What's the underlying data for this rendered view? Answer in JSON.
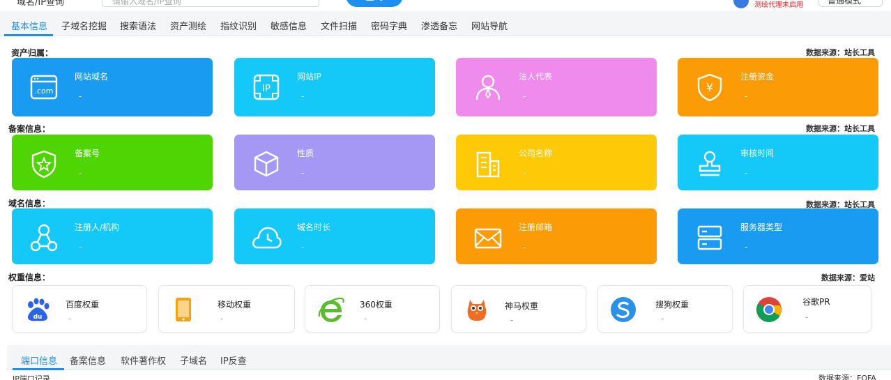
{
  "topbar": {
    "left_text": "域名/IP查询",
    "search_placeholder": "请输入域名/IP查询",
    "query_button": "查询",
    "proxy_status": "测绘代理未启用",
    "mode_select": "普通模式"
  },
  "nav": {
    "tabs": [
      "基本信息",
      "子域名挖掘",
      "搜索语法",
      "资产测绘",
      "指纹识别",
      "敏感信息",
      "文件扫描",
      "密码字典",
      "渗透备忘",
      "网站导航"
    ],
    "active": "基本信息"
  },
  "sections": {
    "asset": {
      "title": "资产归属：",
      "source": "数据来源：站长工具"
    },
    "icp": {
      "title": "备案信息：",
      "source": "数据来源：站长工具"
    },
    "domain": {
      "title": "域名信息：",
      "source": "数据来源：站长工具"
    },
    "weight": {
      "title": "权重信息：",
      "source": "数据来源：爱站"
    }
  },
  "cards": {
    "site_domain": {
      "label": "网站域名",
      "value": "-",
      "color": "#1a9bf2",
      "icon": "domain-com-icon"
    },
    "site_ip": {
      "label": "网站IP",
      "value": "-",
      "color": "#14c8f7",
      "icon": "ip-icon"
    },
    "legal_rep": {
      "label": "法人代表",
      "value": "-",
      "color": "#f08bee",
      "icon": "person-icon"
    },
    "reg_capital": {
      "label": "注册资金",
      "value": "-",
      "color": "#fb9b06",
      "icon": "yuan-shield-icon"
    },
    "icp_no": {
      "label": "备案号",
      "value": "-",
      "color": "#4fd404",
      "icon": "star-shield-icon"
    },
    "nature": {
      "label": "性质",
      "value": "-",
      "color": "#a598f4",
      "icon": "cube-icon"
    },
    "company": {
      "label": "公司名称",
      "value": "-",
      "color": "#fec907",
      "icon": "building-icon"
    },
    "audit_time": {
      "label": "审核时间",
      "value": "-",
      "color": "#14c8f7",
      "icon": "stamp-icon"
    },
    "registrant": {
      "label": "注册人/机构",
      "value": "-",
      "color": "#14c8f7",
      "icon": "share-nodes-icon"
    },
    "domain_age": {
      "label": "域名时长",
      "value": "-",
      "color": "#14c8f7",
      "icon": "clock-cloud-icon"
    },
    "reg_email": {
      "label": "注册邮箱",
      "value": "-",
      "color": "#fb9b06",
      "icon": "mail-icon"
    },
    "server_type": {
      "label": "服务器类型",
      "value": "-",
      "color": "#1a9bf2",
      "icon": "server-icon"
    }
  },
  "weights": [
    {
      "label": "百度权重",
      "value": "-",
      "icon": "baidu-icon"
    },
    {
      "label": "移动权重",
      "value": "-",
      "icon": "mobile-icon"
    },
    {
      "label": "360权重",
      "value": "-",
      "icon": "360-ie-icon"
    },
    {
      "label": "神马权重",
      "value": "-",
      "icon": "shenma-icon"
    },
    {
      "label": "搜狗权重",
      "value": "-",
      "icon": "sogou-icon"
    },
    {
      "label": "谷歌PR",
      "value": "-",
      "icon": "chrome-icon"
    }
  ],
  "subnav": {
    "tabs": [
      "端口信息",
      "备案信息",
      "软件著作权",
      "子域名",
      "IP反查"
    ],
    "active": "端口信息"
  },
  "bottom": {
    "left_label": "IP端口记录",
    "right_source": "数据来源：FOFA"
  }
}
